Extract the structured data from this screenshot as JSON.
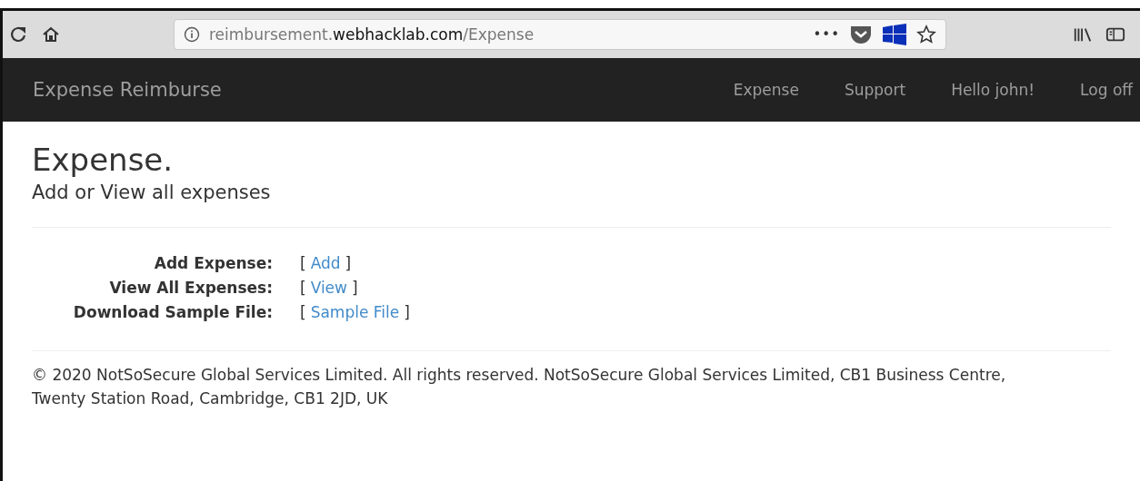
{
  "browser": {
    "url": "reimbursement.**webhacklab.com**/Expense",
    "page_actions": "•••"
  },
  "navbar": {
    "brand": "Expense Reimburse",
    "items": [
      {
        "label": "Expense"
      },
      {
        "label": "Support"
      },
      {
        "label": "Hello john!"
      },
      {
        "label": "Log off"
      }
    ]
  },
  "page": {
    "title": "Expense.",
    "subtitle": "Add or View all expenses",
    "rows": [
      {
        "label": "Add Expense:",
        "open": "[",
        "link": "Add",
        "close": "]"
      },
      {
        "label": "View All Expenses:",
        "open": "[",
        "link": "View",
        "close": "]"
      },
      {
        "label": "Download Sample File:",
        "open": "[",
        "link": "Sample File",
        "close": "]"
      }
    ]
  },
  "footer": {
    "text": "© 2020 NotSoSecure Global Services Limited. All rights reserved. NotSoSecure Global Services Limited, CB1 Business Centre, Twenty Station Road, Cambridge, CB1 2JD, UK"
  }
}
